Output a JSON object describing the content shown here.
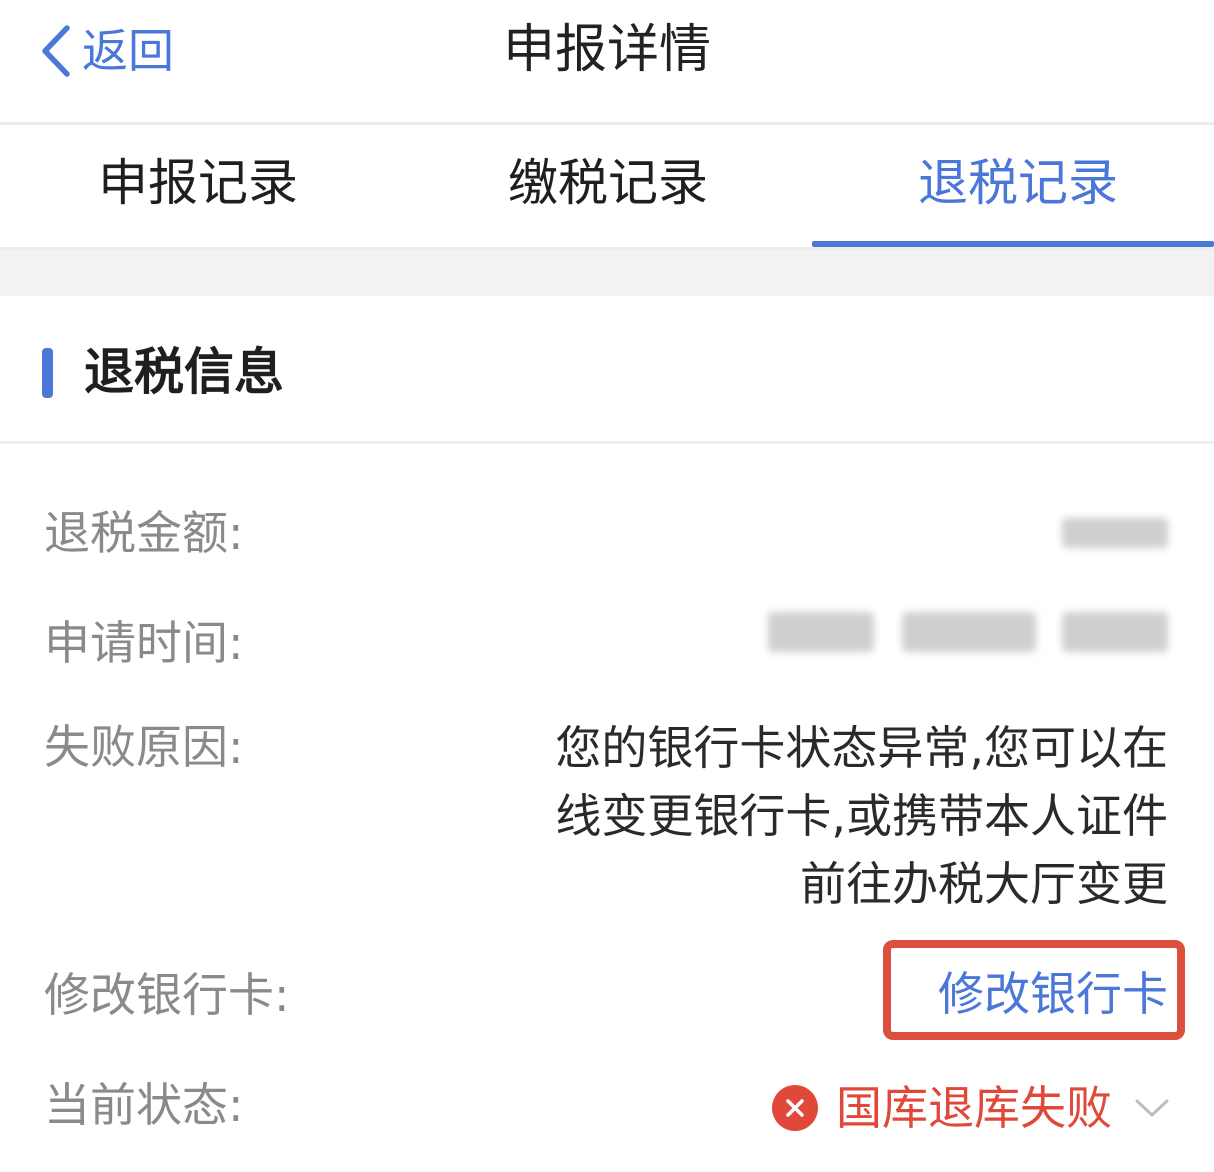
{
  "header": {
    "back_label": "返回",
    "title": "申报详情"
  },
  "tabs": [
    {
      "label": "申报记录",
      "active": false
    },
    {
      "label": "缴税记录",
      "active": false
    },
    {
      "label": "退税记录",
      "active": true
    }
  ],
  "section": {
    "title": "退税信息"
  },
  "rows": {
    "amount_label": "退税金额:",
    "time_label": "申请时间:",
    "reason_label": "失败原因:",
    "reason_value": "您的银行卡状态异常,您可以在线变更银行卡,或携带本人证件前往办税大厅变更",
    "modify_label": "修改银行卡:",
    "modify_link": "修改银行卡",
    "status_label": "当前状态:",
    "status_value": "国库退库失败"
  },
  "colors": {
    "accent": "#4a77d8",
    "error": "#e0493a",
    "highlight": "#dc4f3c"
  },
  "icons": {
    "back": "chevron-left-icon",
    "status": "error-circle-x-icon",
    "expand": "chevron-down-icon"
  }
}
